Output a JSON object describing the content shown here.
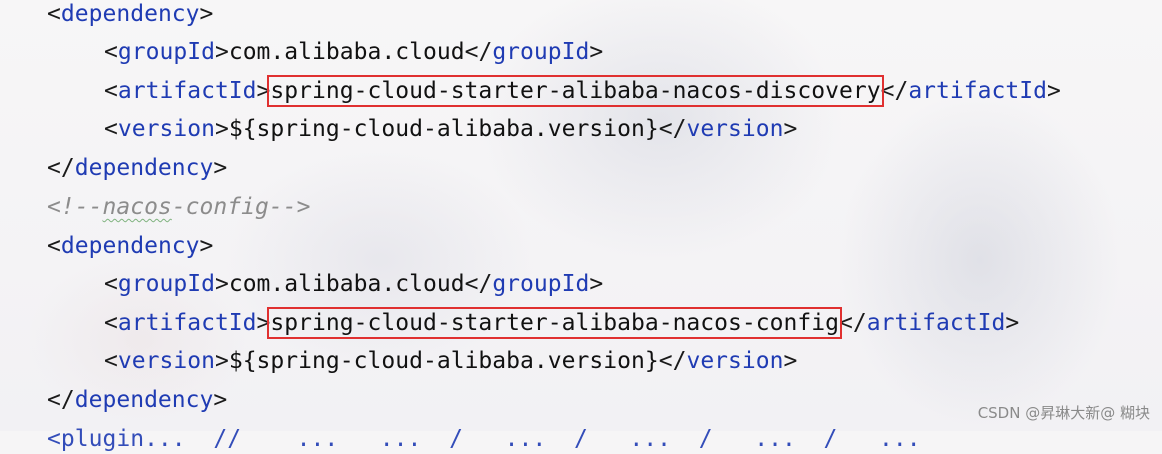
{
  "lines": {
    "l1": {
      "open": "<",
      "tag": "dependency",
      "close": ">"
    },
    "l2": {
      "tag1": "groupId",
      "text": "com.alibaba.cloud",
      "tag2": "groupId"
    },
    "l3": {
      "tag1": "artifactId",
      "text": "spring-cloud-starter-alibaba-nacos-discovery",
      "tag2": "artifactId"
    },
    "l4": {
      "tag1": "version",
      "text": "${spring-cloud-alibaba.version}",
      "tag2": "version"
    },
    "l5": {
      "tag": "dependency"
    },
    "l6": {
      "comment_open": "<!--",
      "comment_body": "nacos",
      "comment_rest": "-config-->"
    },
    "l7": {
      "tag": "dependency"
    },
    "l8": {
      "tag1": "groupId",
      "text": "com.alibaba.cloud",
      "tag2": "groupId"
    },
    "l9": {
      "tag1": "artifactId",
      "text": "spring-cloud-starter-alibaba-nacos-config",
      "tag2": "artifactId"
    },
    "l10": {
      "tag1": "version",
      "text": "${spring-cloud-alibaba.version}",
      "tag2": "version"
    },
    "l11": {
      "tag": "dependency"
    },
    "l12": {
      "partial": "<plugin...  //    ...   ...  /   ...  /   ...  /   ...  /   ..."
    }
  },
  "watermark": "CSDN @昇琳大新@ 糊块",
  "colors": {
    "tag": "#1f3bb3",
    "text": "#111111",
    "comment": "#8c8c8c",
    "highlight": "#e03030"
  }
}
